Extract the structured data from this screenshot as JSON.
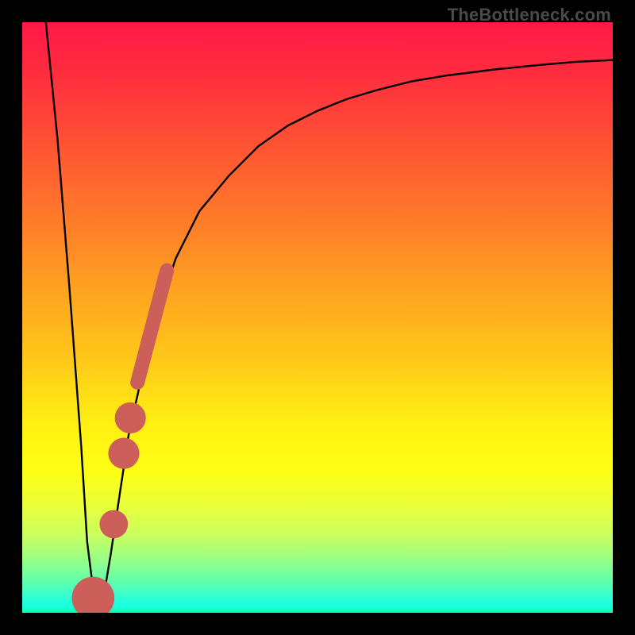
{
  "watermark": "TheBottleneck.com",
  "colors": {
    "frame": "#000000",
    "curve": "#000000",
    "marker": "#cd5f5a",
    "gradient_top": "#ff1846",
    "gradient_mid": "#ffcb18",
    "gradient_bottom": "#0cffa6"
  },
  "chart_data": {
    "type": "line",
    "title": "",
    "xlabel": "",
    "ylabel": "",
    "xlim": [
      0,
      100
    ],
    "ylim": [
      0,
      100
    ],
    "grid": false,
    "legend": false,
    "series": [
      {
        "name": "bottleneck-curve",
        "x": [
          4,
          6,
          8,
          10,
          11,
          12,
          13,
          14,
          15,
          18,
          22,
          26,
          30,
          35,
          40,
          45,
          50,
          55,
          60,
          66,
          72,
          80,
          88,
          94,
          100
        ],
        "y": [
          100,
          80,
          55,
          28,
          12,
          4,
          2,
          4,
          10,
          30,
          48,
          60,
          68,
          74,
          79,
          82.5,
          85,
          87,
          88.5,
          90,
          91,
          92,
          92.8,
          93.3,
          93.6
        ]
      }
    ],
    "markers": [
      {
        "name": "highlight-segment-upper",
        "shape": "rounded-bar",
        "x_range": [
          19.5,
          24.5
        ],
        "y_range": [
          39,
          58
        ],
        "color": "#cd5f5a"
      },
      {
        "name": "highlight-dot-mid",
        "shape": "dot",
        "x": 18.3,
        "y": 33,
        "r": 2.2,
        "color": "#cd5f5a"
      },
      {
        "name": "highlight-dot-lower-1",
        "shape": "dot",
        "x": 17.2,
        "y": 27,
        "r": 2.2,
        "color": "#cd5f5a"
      },
      {
        "name": "highlight-dot-lower-2",
        "shape": "dot",
        "x": 15.5,
        "y": 15,
        "r": 2.0,
        "color": "#cd5f5a"
      },
      {
        "name": "valley-dot",
        "shape": "dot",
        "x": 12.0,
        "y": 2.5,
        "r": 3.0,
        "color": "#cd5f5a"
      }
    ]
  }
}
